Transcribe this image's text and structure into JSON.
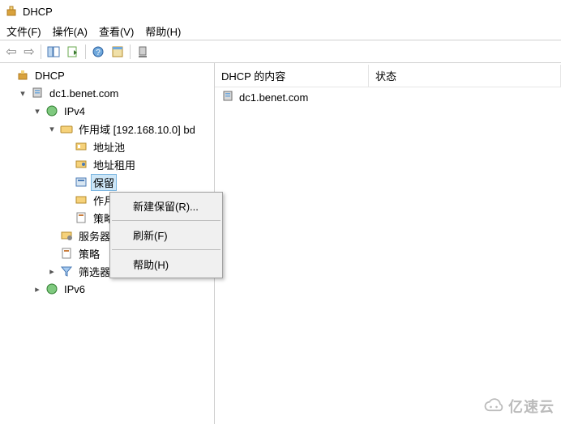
{
  "window": {
    "title": "DHCP"
  },
  "menu": {
    "file": "文件(F)",
    "action": "操作(A)",
    "view": "查看(V)",
    "help": "帮助(H)"
  },
  "toolbar": {
    "back": "←",
    "forward": "→"
  },
  "tree": {
    "root": {
      "label": "DHCP"
    },
    "server": {
      "label": "dc1.benet.com"
    },
    "ipv4": {
      "label": "IPv4"
    },
    "scope": {
      "label": "作用域 [192.168.10.0] bd"
    },
    "addresspool": {
      "label": "地址池"
    },
    "addresslease": {
      "label": "地址租用"
    },
    "reservations": {
      "label": "保留"
    },
    "zuoyong": {
      "label": "作月"
    },
    "celue": {
      "label": "策略"
    },
    "serveroptions": {
      "label": "服务器"
    },
    "policy": {
      "label": "策略"
    },
    "filter": {
      "label": "筛选器"
    },
    "ipv6": {
      "label": "IPv6"
    }
  },
  "list": {
    "header": {
      "col1": "DHCP 的内容",
      "col2": "状态"
    },
    "rows": [
      {
        "name": "dc1.benet.com"
      }
    ]
  },
  "context_menu": {
    "new_reservation": "新建保留(R)...",
    "refresh": "刷新(F)",
    "help": "帮助(H)"
  },
  "watermark": {
    "text": "亿速云"
  }
}
